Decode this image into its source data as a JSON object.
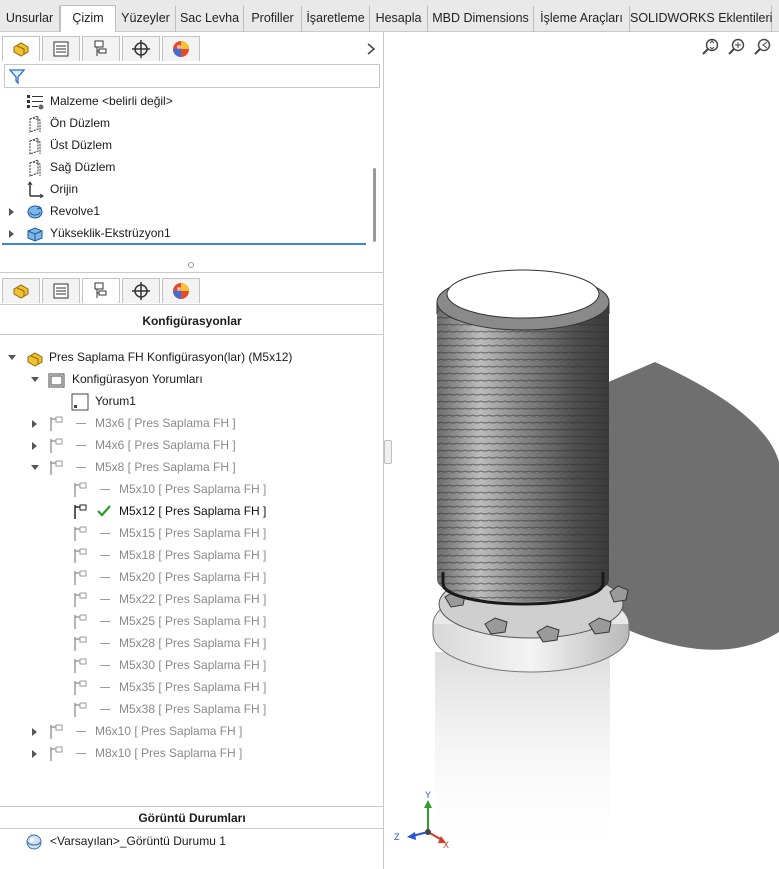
{
  "tabs": [
    {
      "label": "Unsurlar",
      "active": false
    },
    {
      "label": "Çizim",
      "active": true
    },
    {
      "label": "Yüzeyler",
      "active": false
    },
    {
      "label": "Sac Levha",
      "active": false
    },
    {
      "label": "Profiller",
      "active": false
    },
    {
      "label": "İşaretleme",
      "active": false
    },
    {
      "label": "Hesapla",
      "active": false
    },
    {
      "label": "MBD Dimensions",
      "active": false
    },
    {
      "label": "İşleme Araçları",
      "active": false
    },
    {
      "label": "SOLIDWORKS Eklentileri",
      "active": false
    }
  ],
  "feature_tree": {
    "items": [
      {
        "label": "Malzeme <belirli değil>",
        "icon": "material-icon"
      },
      {
        "label": "Ön Düzlem",
        "icon": "plane-icon"
      },
      {
        "label": "Üst Düzlem",
        "icon": "plane-icon"
      },
      {
        "label": "Sağ Düzlem",
        "icon": "plane-icon"
      },
      {
        "label": "Orijin",
        "icon": "origin-icon"
      },
      {
        "label": "Revolve1",
        "icon": "revolve-icon"
      },
      {
        "label": "Yükseklik-Ekstrüzyon1",
        "icon": "extrude-icon"
      }
    ]
  },
  "config_panel": {
    "title": "Konfigürasyonlar",
    "root": "Pres Saplama FH Konfigürasyon(lar)  (M5x12)",
    "comments_folder": "Konfigürasyon Yorumları",
    "comment": "Yorum1",
    "configs": [
      {
        "label": "M3x6 [ Pres Saplama FH ]",
        "level": 1,
        "state": "collapsed"
      },
      {
        "label": "M4x6 [ Pres Saplama FH ]",
        "level": 1,
        "state": "collapsed"
      },
      {
        "label": "M5x8 [ Pres Saplama FH ]",
        "level": 1,
        "state": "expanded"
      },
      {
        "label": "M5x10 [ Pres Saplama FH ]",
        "level": 2,
        "state": "leaf"
      },
      {
        "label": "M5x12 [ Pres Saplama FH ]",
        "level": 2,
        "state": "active"
      },
      {
        "label": "M5x15 [ Pres Saplama FH ]",
        "level": 2,
        "state": "leaf"
      },
      {
        "label": "M5x18 [ Pres Saplama FH ]",
        "level": 2,
        "state": "leaf"
      },
      {
        "label": "M5x20 [ Pres Saplama FH ]",
        "level": 2,
        "state": "leaf"
      },
      {
        "label": "M5x22 [ Pres Saplama FH ]",
        "level": 2,
        "state": "leaf"
      },
      {
        "label": "M5x25 [ Pres Saplama FH ]",
        "level": 2,
        "state": "leaf"
      },
      {
        "label": "M5x28 [ Pres Saplama FH ]",
        "level": 2,
        "state": "leaf"
      },
      {
        "label": "M5x30 [ Pres Saplama FH ]",
        "level": 2,
        "state": "leaf"
      },
      {
        "label": "M5x35 [ Pres Saplama FH ]",
        "level": 2,
        "state": "leaf"
      },
      {
        "label": "M5x38 [ Pres Saplama FH ]",
        "level": 2,
        "state": "leaf"
      },
      {
        "label": "M6x10 [ Pres Saplama FH ]",
        "level": 1,
        "state": "collapsed"
      },
      {
        "label": "M8x10 [ Pres Saplama FH ]",
        "level": 1,
        "state": "collapsed"
      }
    ]
  },
  "display_states": {
    "title": "Görüntü Durumları",
    "item": "<Varsayılan>_Görüntü Durumu 1"
  },
  "triad": {
    "x": "X",
    "y": "Y",
    "z": "Z"
  },
  "colors": {
    "accent_blue": "#3d86d6",
    "check_green": "#2e9a2e",
    "disabled_text": "#8a8a8a"
  }
}
